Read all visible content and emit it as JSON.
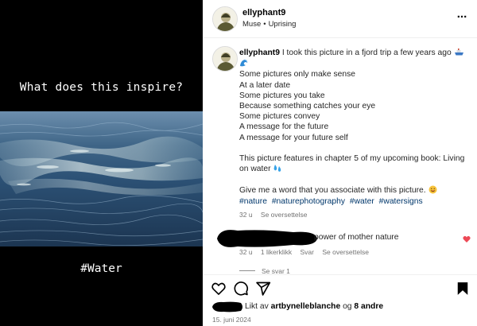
{
  "media": {
    "top_text": "What does this inspire?",
    "bottom_text": "#Water"
  },
  "header": {
    "username": "ellyphant9",
    "audio": "Muse",
    "separator": "•",
    "track": "Uprising",
    "more_label": "..."
  },
  "caption": {
    "username": "ellyphant9",
    "first_line": "I took this picture in a fjord trip a few years ago",
    "lines": [
      "Some pictures only make sense",
      "At a later date",
      "Some pictures you take",
      "Because something catches your eye",
      "Some pictures convey",
      "A message for the future",
      "A message for your future self"
    ],
    "book_line": "This picture features in chapter 5 of my upcoming book: Living on water",
    "prompt_line": "Give me a word that you associate with this picture.",
    "hashtags": [
      "#nature",
      "#naturephotography",
      "#water",
      "#watersigns"
    ],
    "time": "32 u",
    "translate": "Se oversettelse"
  },
  "comment": {
    "text": "power of mother nature",
    "time": "32 u",
    "likes": "1 likerklikk",
    "reply": "Svar",
    "translate": "Se oversettelse",
    "view_replies": "Se svar 1"
  },
  "likes": {
    "prefix": "Likt av",
    "user": "artbynelleblanche",
    "middle": "og",
    "others": "8 andre"
  },
  "date": "15. juni 2024",
  "colors": {
    "link": "#00376b",
    "meta": "#737373",
    "heart": "#ed4956"
  }
}
